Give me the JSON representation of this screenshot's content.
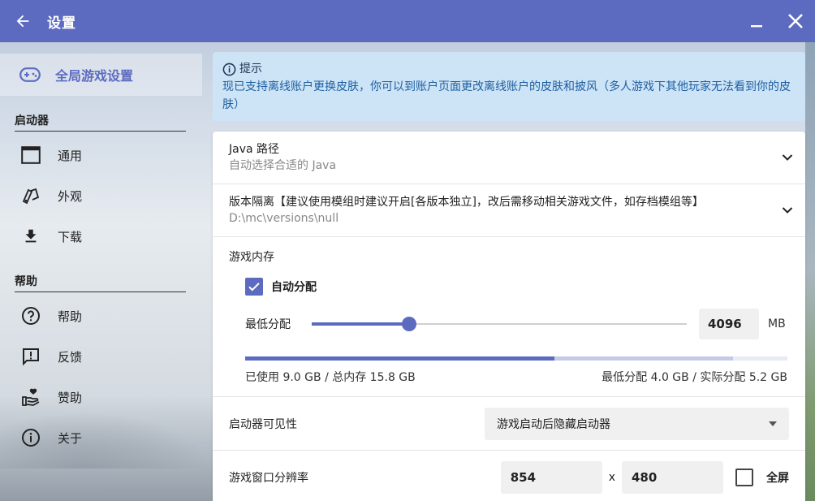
{
  "window": {
    "title": "设置"
  },
  "sidebar": {
    "top_item": {
      "label": "全局游戏设置",
      "icon": "gamepad-icon"
    },
    "sections": [
      {
        "title": "启动器",
        "items": [
          {
            "label": "通用",
            "icon": "window-icon"
          },
          {
            "label": "外观",
            "icon": "palette-icon"
          },
          {
            "label": "下载",
            "icon": "download-icon"
          }
        ]
      },
      {
        "title": "帮助",
        "items": [
          {
            "label": "帮助",
            "icon": "help-icon"
          },
          {
            "label": "反馈",
            "icon": "feedback-icon"
          },
          {
            "label": "赞助",
            "icon": "donate-icon"
          },
          {
            "label": "关于",
            "icon": "info-icon"
          }
        ]
      }
    ]
  },
  "hint": {
    "title": "提示",
    "body": "现已支持离线账户更换皮肤，你可以到账户页面更改离线账户的皮肤和披风（多人游戏下其他玩家无法看到你的皮肤）"
  },
  "java": {
    "title": "Java 路径",
    "subtitle": "自动选择合适的 Java"
  },
  "isolation": {
    "title": "版本隔离【建议使用模组时建议开启[各版本独立]，改后需移动相关游戏文件，如存档模组等】",
    "subtitle": "D:\\mc\\versions\\null"
  },
  "memory": {
    "title": "游戏内存",
    "auto_label": "自动分配",
    "auto_checked": true,
    "min_label": "最低分配",
    "min_value": "4096",
    "unit": "MB",
    "slider_fraction": 0.26,
    "used_fraction": 0.57,
    "allocated_fraction": 0.33,
    "used_text": "已使用 9.0 GB / 总内存 15.8 GB",
    "alloc_text": "最低分配 4.0 GB / 实际分配 5.2 GB"
  },
  "visibility": {
    "label": "启动器可见性",
    "value": "游戏启动后隐藏启动器"
  },
  "resolution": {
    "label": "游戏窗口分辨率",
    "width": "854",
    "height": "480",
    "x": "x",
    "fullscreen_label": "全屏",
    "fullscreen_checked": false
  },
  "colors": {
    "accent": "#5c6bc0",
    "hint_bg": "#cde4f7"
  }
}
